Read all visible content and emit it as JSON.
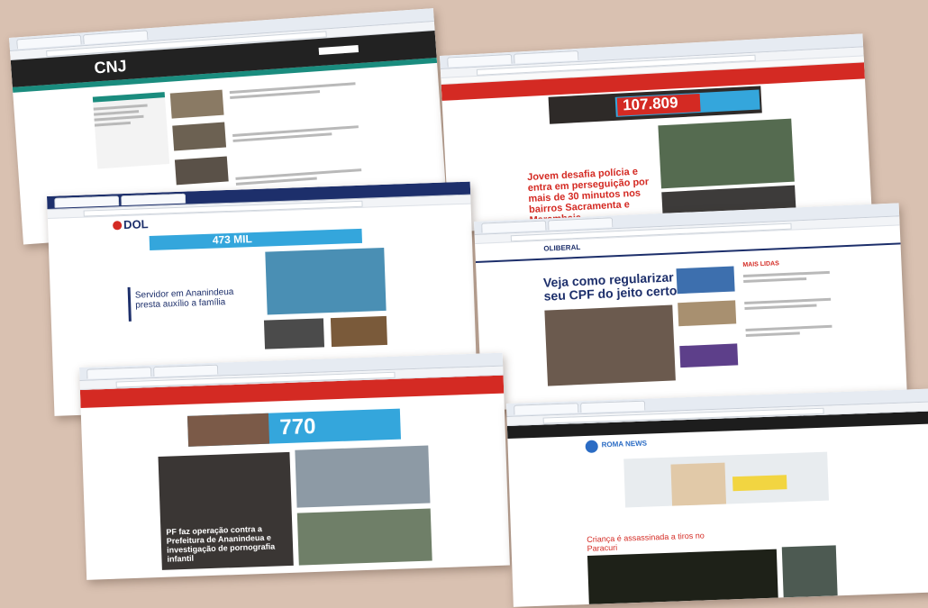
{
  "screens": {
    "cnj": {
      "logo": "CNJ"
    },
    "agencia_top": {
      "banner_number": "107.809",
      "headline": "Jovem desafia polícia e entra em perseguição por mais de 30 minutos nos bairros Sacramenta e Marambaia"
    },
    "dol": {
      "logo": "DOL",
      "banner_number": "473 MIL",
      "headline": "Servidor em Ananindeua presta auxílio a família"
    },
    "oliberal": {
      "logo": "OLIBERAL",
      "headline": "Veja como regularizar seu CPF do jeito certo",
      "sidebar_title": "MAIS LIDAS"
    },
    "agencia_bottom": {
      "banner_number": "770",
      "headline": "PF faz operação contra a Prefeitura de Ananindeua e investigação de pornografia infantil"
    },
    "roma": {
      "logo": "ROMA NEWS",
      "headline": "Criança é assassinada a tiros no Paracuri"
    }
  },
  "colors": {
    "background": "#d9c1b1",
    "red": "#d42a23",
    "teal": "#1a8c7e",
    "navy": "#1d2f6b",
    "banner_blue": "#34a6dc"
  }
}
